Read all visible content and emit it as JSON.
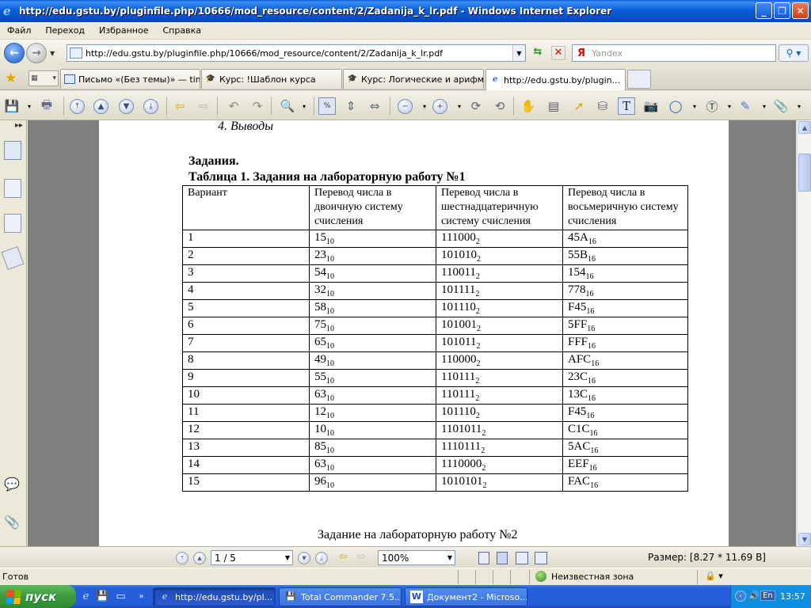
{
  "window": {
    "title": "http://edu.gstu.by/pluginfile.php/10666/mod_resource/content/2/Zadanija_k_lr.pdf - Windows Internet Explorer",
    "buttons": [
      "_",
      "❐",
      "✕"
    ]
  },
  "menu": [
    "Файл",
    "Переход",
    "Избранное",
    "Справка"
  ],
  "address": {
    "url": "http://edu.gstu.by/pluginfile.php/10666/mod_resource/content/2/Zadanija_k_lr.pdf",
    "search_brand": "Я",
    "search_placeholder": "Yandex"
  },
  "tabs": [
    {
      "label": "Письмо «(Без темы)» — tim...",
      "icon": "mail-icon",
      "active": false
    },
    {
      "label": "Курс: !Шаблон курса",
      "icon": "moodle-icon",
      "active": false
    },
    {
      "label": "Курс: Логические и арифме...",
      "icon": "moodle-icon",
      "active": false
    },
    {
      "label": "http://edu.gstu.by/plugin...",
      "icon": "ie-icon",
      "active": true
    }
  ],
  "document": {
    "prev_item": "4.  Выводы",
    "heading": "Задания.",
    "table_title": "Таблица 1. Задания на лабораторную работу №1",
    "headers": [
      "Вариант",
      "Перевод числа в двоичную систему счисления",
      "Перевод числа в шестнадцатеричную систему счисления",
      "Перевод числа в восьмеричную систему счисления"
    ],
    "rows": [
      {
        "variant": "1",
        "bin": "15",
        "bin_sub": "10",
        "hex": "111000",
        "hex_sub": "2",
        "oct": "45A",
        "oct_sub": "16"
      },
      {
        "variant": "2",
        "bin": "23",
        "bin_sub": "10",
        "hex": "101010",
        "hex_sub": "2",
        "oct": "55B",
        "oct_sub": "16"
      },
      {
        "variant": "3",
        "bin": "54",
        "bin_sub": "10",
        "hex": "110011",
        "hex_sub": "2",
        "oct": "154",
        "oct_sub": "16"
      },
      {
        "variant": "4",
        "bin": "32",
        "bin_sub": "10",
        "hex": "101111",
        "hex_sub": "2",
        "oct": "778",
        "oct_sub": "16"
      },
      {
        "variant": "5",
        "bin": "58",
        "bin_sub": "10",
        "hex": "101110",
        "hex_sub": "2",
        "oct": "F45",
        "oct_sub": "16"
      },
      {
        "variant": "6",
        "bin": "75",
        "bin_sub": "10",
        "hex": "101001",
        "hex_sub": "2",
        "oct": "5FF",
        "oct_sub": "16"
      },
      {
        "variant": "7",
        "bin": "65",
        "bin_sub": "10",
        "hex": "101011",
        "hex_sub": "2",
        "oct": "FFF",
        "oct_sub": "16"
      },
      {
        "variant": "8",
        "bin": "49",
        "bin_sub": "10",
        "hex": "110000",
        "hex_sub": "2",
        "oct": "AFC",
        "oct_sub": "16"
      },
      {
        "variant": "9",
        "bin": "55",
        "bin_sub": "10",
        "hex": "110111",
        "hex_sub": "2",
        "oct": "23C",
        "oct_sub": "16"
      },
      {
        "variant": "10",
        "bin": "63",
        "bin_sub": "10",
        "hex": "110111",
        "hex_sub": "2",
        "oct": "13C",
        "oct_sub": "16"
      },
      {
        "variant": "11",
        "bin": "12",
        "bin_sub": "10",
        "hex": "101110",
        "hex_sub": "2",
        "oct": "F45",
        "oct_sub": "16"
      },
      {
        "variant": "12",
        "bin": "10",
        "bin_sub": "10",
        "hex": "1101011",
        "hex_sub": "2",
        "oct": "C1C",
        "oct_sub": "16"
      },
      {
        "variant": "13",
        "bin": "85",
        "bin_sub": "10",
        "hex": "1110111",
        "hex_sub": "2",
        "oct": "5AC",
        "oct_sub": "16"
      },
      {
        "variant": "14",
        "bin": "63",
        "bin_sub": "10",
        "hex": "1110000",
        "hex_sub": "2",
        "oct": "EEF",
        "oct_sub": "16"
      },
      {
        "variant": "15",
        "bin": "96",
        "bin_sub": "10",
        "hex": "1010101",
        "hex_sub": "2",
        "oct": "FAC",
        "oct_sub": "16"
      }
    ],
    "next_section": "Задание на лабораторную работу №2"
  },
  "pdf_nav": {
    "page": "1 / 5",
    "zoom": "100%",
    "size": "Размер: [8.27 * 11.69 B]"
  },
  "status": {
    "ready": "Готов",
    "zone": "Неизвестная зона",
    "zoom": "🔒 ▾"
  },
  "taskbar": {
    "start": "пуск",
    "items": [
      {
        "label": "http://edu.gstu.by/pl...",
        "active": true
      },
      {
        "label": "Total Commander 7.5...",
        "active": false
      },
      {
        "label": "Документ2 - Microso...",
        "active": false
      }
    ],
    "lang": "En",
    "clock": "13:57"
  }
}
